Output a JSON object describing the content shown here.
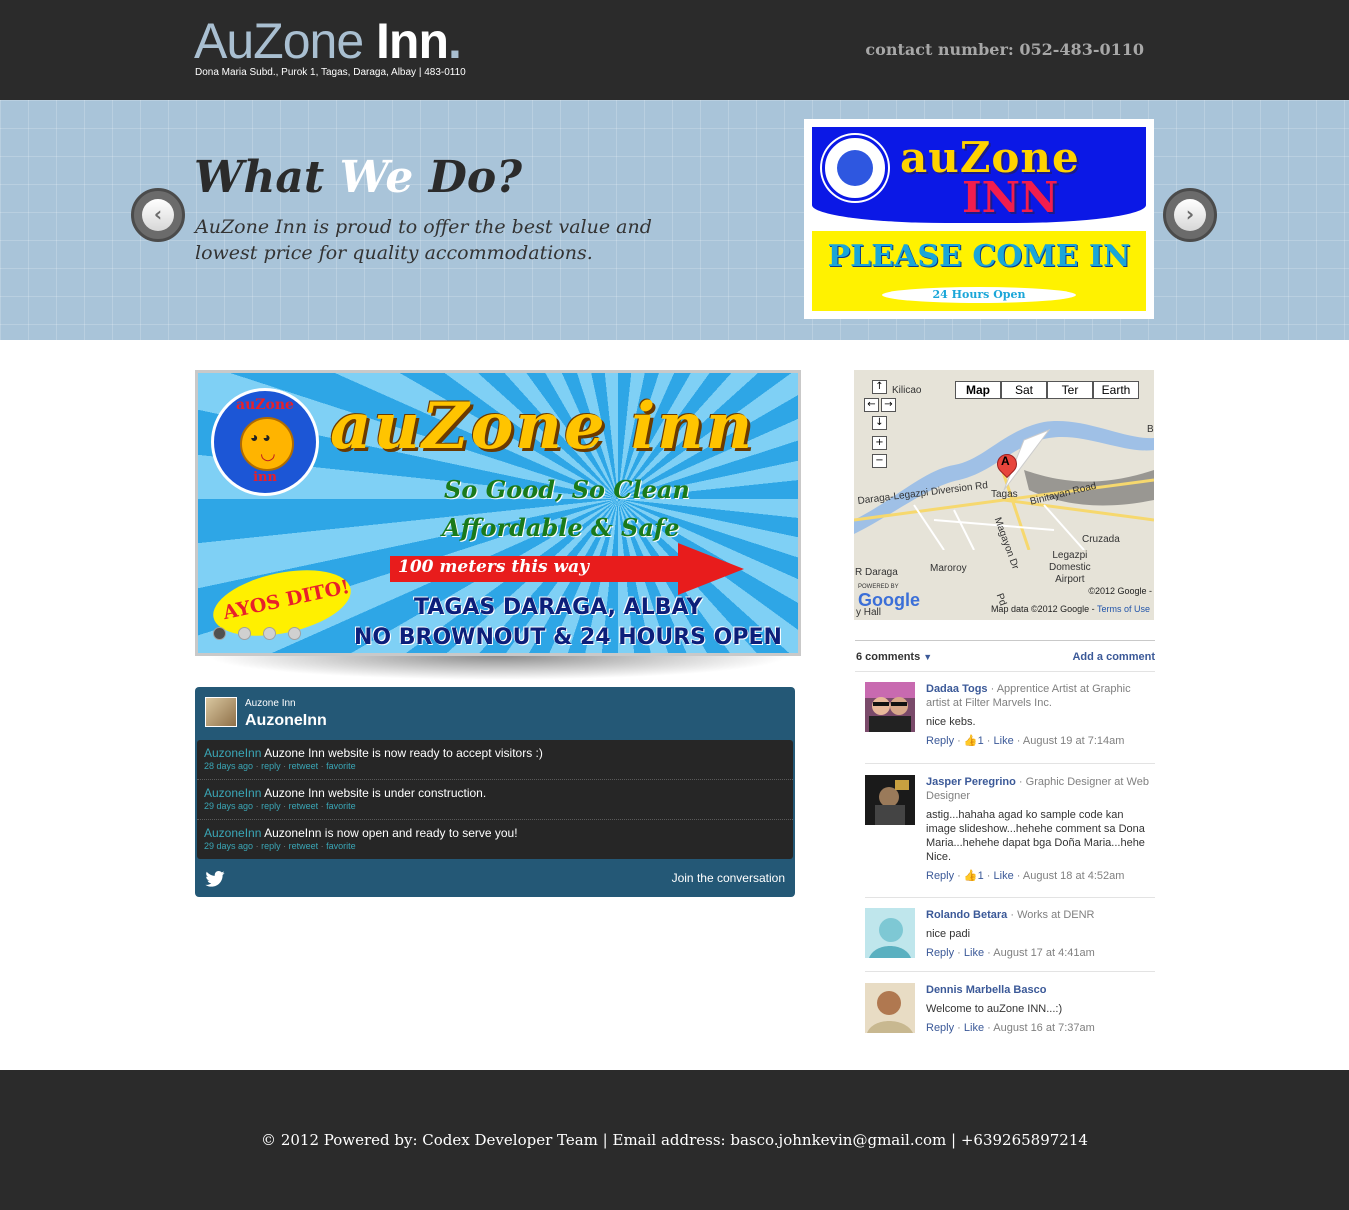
{
  "header": {
    "brand_word1": "AuZone",
    "brand_word2": "Inn",
    "brand_dot": ".",
    "address": "Dona Maria Subd., Purok 1, Tagas, Daraga, Albay | 483-0110",
    "contact": "contact number: 052-483-0110"
  },
  "hero": {
    "title_part1": "What",
    "title_part2": "We",
    "title_part3": "Do?",
    "text": "AuZone Inn is proud to offer the best value and lowest price for quality accommodations.",
    "prev_icon": "‹",
    "next_icon": "›",
    "sign": {
      "line1": "auZone",
      "line2": "INN",
      "come_in": "PLEASE COME IN",
      "hours": "24 Hours Open"
    }
  },
  "banner": {
    "logo_top": "auZone",
    "logo_bottom": "inn",
    "title": "auZone inn",
    "sub1": "So Good, So Clean",
    "sub2": "Affordable & Safe",
    "arrow_text": "100 meters this way",
    "ayos": "AYOS DITO!",
    "loc1": "TAGAS DARAGA, ALBAY",
    "loc2": "NO BROWNOUT & 24 HOURS OPEN",
    "slide_count": 4,
    "active_slide": 1
  },
  "twitter": {
    "name": "Auzone Inn",
    "handle": "AuzoneInn",
    "tweets": [
      {
        "user": "AuzoneInn",
        "text": "Auzone Inn website is now ready to accept visitors :)",
        "time": "28 days ago",
        "reply": "reply",
        "retweet": "retweet",
        "favorite": "favorite"
      },
      {
        "user": "AuzoneInn",
        "text": "Auzone Inn website is under construction.",
        "time": "29 days ago",
        "reply": "reply",
        "retweet": "retweet",
        "favorite": "favorite"
      },
      {
        "user": "AuzoneInn",
        "text": "AuzoneInn is now open and ready to serve you!",
        "time": "29 days ago",
        "reply": "reply",
        "retweet": "retweet",
        "favorite": "favorite"
      }
    ],
    "join": "Join the conversation"
  },
  "map": {
    "types": [
      "Map",
      "Sat",
      "Ter",
      "Earth"
    ],
    "active_type": "Map",
    "pin": "A",
    "labels": {
      "kilicao": "Kilicao",
      "tagas": "Tagas",
      "diversion": "Daraga-Legazpi Diversion Rd",
      "binitayan": "Binitayan Road",
      "cruzada": "Cruzada",
      "daraga": "R Daraga",
      "maroroy": "Maroroy",
      "airport": "Legazpi\nDomestic\nAirport",
      "hall": "y Hall",
      "b": "B",
      "magayon": "Magayon Dr",
      "pd": "Pd"
    },
    "copyright": "©2012 Google -",
    "data_text": "Map data ©2012 Google -",
    "terms": "Terms of Use",
    "powered": "POWERED BY",
    "google": "Google"
  },
  "comments": {
    "count": "6 comments",
    "add": "Add a comment",
    "items": [
      {
        "name": "Dadaa Togs",
        "role": " · Apprentice Artist at Graphic artist at Filter Marvels Inc.",
        "text": "nice kebs.",
        "reply": "Reply",
        "likes": "1",
        "like": "Like",
        "time": "August 19 at 7:14am"
      },
      {
        "name": "Jasper Peregrino",
        "role": " · Graphic Designer at Web Designer",
        "text": "astig...hahaha agad ko sample code kan image slideshow...hehehe comment sa Dona Maria...hehehe dapat bga Doña Maria...hehe Nice.",
        "reply": "Reply",
        "likes": "1",
        "like": "Like",
        "time": "August 18 at 4:52am"
      },
      {
        "name": "Rolando Betara",
        "role": " · Works at DENR",
        "text": "nice padi",
        "reply": "Reply",
        "likes": "",
        "like": "Like",
        "time": "August 17 at 4:41am"
      },
      {
        "name": "Dennis Marbella Basco",
        "role": "",
        "text": "Welcome to auZone INN...:)",
        "reply": "Reply",
        "likes": "",
        "like": "Like",
        "time": "August 16 at 7:37am"
      }
    ]
  },
  "footer": {
    "text": "© 2012 Powered by: Codex Developer Team | Email address: basco.johnkevin@gmail.com | +639265897214"
  },
  "colors": {
    "dark": "#2b2b2b",
    "hero_bg": "#a9c4d9",
    "twitter_bg": "#245876",
    "fb_link": "#3b5998"
  }
}
